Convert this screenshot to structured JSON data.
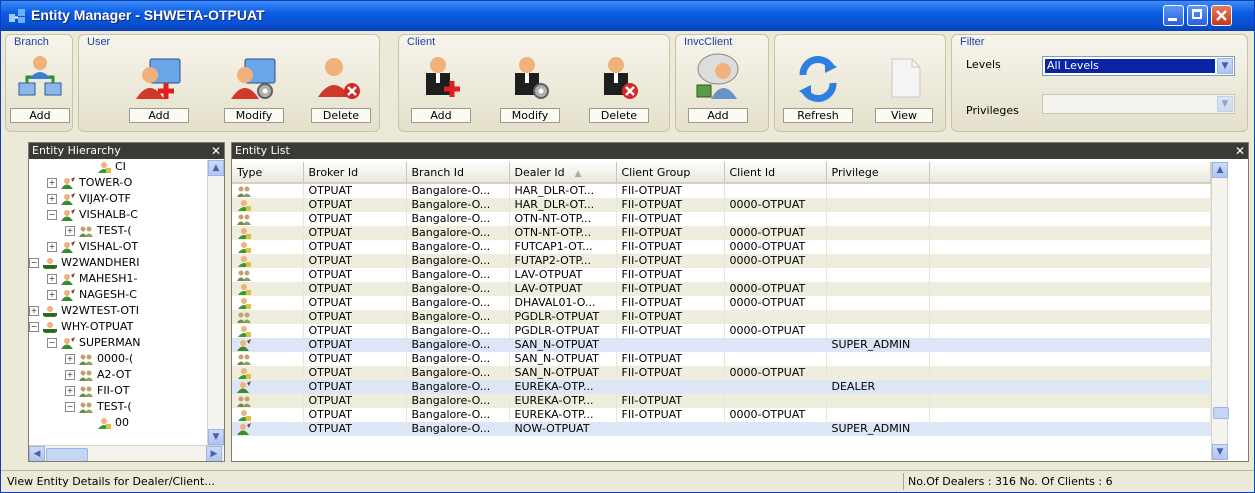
{
  "window": {
    "title": "Entity Manager - SHWETA-OTPUAT"
  },
  "toolbar": {
    "groups": [
      {
        "label": "Branch",
        "buttons": [
          "Add"
        ]
      },
      {
        "label": "User",
        "buttons": [
          "Add",
          "Modify",
          "Delete"
        ]
      },
      {
        "label": "Client",
        "buttons": [
          "Add",
          "Modify",
          "Delete"
        ]
      },
      {
        "label": "InvcClient",
        "buttons": [
          "Add"
        ]
      },
      {
        "label": "",
        "buttons": [
          "Refresh",
          "View"
        ]
      }
    ],
    "icons": {
      "branch_add": "branch-add-icon",
      "user_add": "user-add-icon",
      "user_modify": "user-modify-icon",
      "user_delete": "user-delete-icon",
      "client_add": "client-add-icon",
      "client_modify": "client-modify-icon",
      "client_delete": "client-delete-icon",
      "invc_add": "invc-client-add-icon",
      "refresh": "refresh-icon",
      "view": "view-document-icon"
    }
  },
  "filter": {
    "label": "Filter",
    "levels_label": "Levels",
    "levels_value": "All Levels",
    "privileges_label": "Privileges",
    "privileges_value": ""
  },
  "tree": {
    "title": "Entity Hierarchy",
    "items": [
      {
        "text": "CI",
        "indent": 5,
        "expander": "",
        "icon": "client"
      },
      {
        "text": "TOWER-O",
        "indent": 3,
        "expander": "+",
        "icon": "dealer"
      },
      {
        "text": "VIJAY-OTF",
        "indent": 3,
        "expander": "+",
        "icon": "dealer"
      },
      {
        "text": "VISHALB-C",
        "indent": 3,
        "expander": "-",
        "icon": "dealer"
      },
      {
        "text": "TEST-(",
        "indent": 4,
        "expander": "+",
        "icon": "group"
      },
      {
        "text": "VISHAL-OT",
        "indent": 3,
        "expander": "+",
        "icon": "dealer"
      },
      {
        "text": "W2WANDHERI",
        "indent": 2,
        "expander": "-",
        "icon": "branch"
      },
      {
        "text": "MAHESH1-",
        "indent": 3,
        "expander": "+",
        "icon": "dealer"
      },
      {
        "text": "NAGESH-C",
        "indent": 3,
        "expander": "+",
        "icon": "dealer"
      },
      {
        "text": "W2WTEST-OTI",
        "indent": 2,
        "expander": "+",
        "icon": "branch"
      },
      {
        "text": "WHY-OTPUAT",
        "indent": 2,
        "expander": "-",
        "icon": "branch"
      },
      {
        "text": "SUPERMAN",
        "indent": 3,
        "expander": "-",
        "icon": "dealer"
      },
      {
        "text": "0000-(",
        "indent": 4,
        "expander": "+",
        "icon": "group"
      },
      {
        "text": "A2-OT",
        "indent": 4,
        "expander": "+",
        "icon": "group"
      },
      {
        "text": "FII-OT",
        "indent": 4,
        "expander": "+",
        "icon": "group"
      },
      {
        "text": "TEST-(",
        "indent": 4,
        "expander": "-",
        "icon": "group"
      },
      {
        "text": "00",
        "indent": 5,
        "expander": "",
        "icon": "client"
      }
    ]
  },
  "list": {
    "title": "Entity List",
    "columns": [
      "Type",
      "Broker Id",
      "Branch Id",
      "Dealer Id",
      "Client Group",
      "Client Id",
      "Privilege"
    ],
    "sort_column": "Dealer Id",
    "rows": [
      {
        "type": "group",
        "broker": "OTPUAT",
        "branch": "Bangalore-O...",
        "dealer": "HAR_DLR-OT...",
        "group": "FII-OTPUAT",
        "client": "",
        "privilege": ""
      },
      {
        "type": "client",
        "broker": "OTPUAT",
        "branch": "Bangalore-O...",
        "dealer": "HAR_DLR-OT...",
        "group": "FII-OTPUAT",
        "client": "0000-OTPUAT",
        "privilege": ""
      },
      {
        "type": "group",
        "broker": "OTPUAT",
        "branch": "Bangalore-O...",
        "dealer": "OTN-NT-OTP...",
        "group": "FII-OTPUAT",
        "client": "",
        "privilege": ""
      },
      {
        "type": "client",
        "broker": "OTPUAT",
        "branch": "Bangalore-O...",
        "dealer": "OTN-NT-OTP...",
        "group": "FII-OTPUAT",
        "client": "0000-OTPUAT",
        "privilege": ""
      },
      {
        "type": "client",
        "broker": "OTPUAT",
        "branch": "Bangalore-O...",
        "dealer": "FUTCAP1-OT...",
        "group": "FII-OTPUAT",
        "client": "0000-OTPUAT",
        "privilege": ""
      },
      {
        "type": "client",
        "broker": "OTPUAT",
        "branch": "Bangalore-O...",
        "dealer": "FUTAP2-OTP...",
        "group": "FII-OTPUAT",
        "client": "0000-OTPUAT",
        "privilege": ""
      },
      {
        "type": "group",
        "broker": "OTPUAT",
        "branch": "Bangalore-O...",
        "dealer": "LAV-OTPUAT",
        "group": "FII-OTPUAT",
        "client": "",
        "privilege": ""
      },
      {
        "type": "client",
        "broker": "OTPUAT",
        "branch": "Bangalore-O...",
        "dealer": "LAV-OTPUAT",
        "group": "FII-OTPUAT",
        "client": "0000-OTPUAT",
        "privilege": ""
      },
      {
        "type": "client",
        "broker": "OTPUAT",
        "branch": "Bangalore-O...",
        "dealer": "DHAVAL01-O...",
        "group": "FII-OTPUAT",
        "client": "0000-OTPUAT",
        "privilege": ""
      },
      {
        "type": "group",
        "broker": "OTPUAT",
        "branch": "Bangalore-O...",
        "dealer": "PGDLR-OTPUAT",
        "group": "FII-OTPUAT",
        "client": "",
        "privilege": ""
      },
      {
        "type": "client",
        "broker": "OTPUAT",
        "branch": "Bangalore-O...",
        "dealer": "PGDLR-OTPUAT",
        "group": "FII-OTPUAT",
        "client": "0000-OTPUAT",
        "privilege": ""
      },
      {
        "type": "dealer",
        "broker": "OTPUAT",
        "branch": "Bangalore-O...",
        "dealer": "SAN_N-OTPUAT",
        "group": "",
        "client": "",
        "privilege": "SUPER_ADMIN"
      },
      {
        "type": "group",
        "broker": "OTPUAT",
        "branch": "Bangalore-O...",
        "dealer": "SAN_N-OTPUAT",
        "group": "FII-OTPUAT",
        "client": "",
        "privilege": ""
      },
      {
        "type": "client",
        "broker": "OTPUAT",
        "branch": "Bangalore-O...",
        "dealer": "SAN_N-OTPUAT",
        "group": "FII-OTPUAT",
        "client": "0000-OTPUAT",
        "privilege": ""
      },
      {
        "type": "dealer",
        "broker": "OTPUAT",
        "branch": "Bangalore-O...",
        "dealer": "EUREKA-OTP...",
        "group": "",
        "client": "",
        "privilege": "DEALER"
      },
      {
        "type": "group",
        "broker": "OTPUAT",
        "branch": "Bangalore-O...",
        "dealer": "EUREKA-OTP...",
        "group": "FII-OTPUAT",
        "client": "",
        "privilege": ""
      },
      {
        "type": "client",
        "broker": "OTPUAT",
        "branch": "Bangalore-O...",
        "dealer": "EUREKA-OTP...",
        "group": "FII-OTPUAT",
        "client": "0000-OTPUAT",
        "privilege": ""
      },
      {
        "type": "dealer",
        "broker": "OTPUAT",
        "branch": "Bangalore-O...",
        "dealer": "NOW-OTPUAT",
        "group": "",
        "client": "",
        "privilege": "SUPER_ADMIN"
      }
    ]
  },
  "status": {
    "left": "View Entity Details for Dealer/Client...",
    "right": "No.Of Dealers : 316 No. Of Clients : 6"
  },
  "colors": {
    "title_bar": "#0b5ce4",
    "group_label": "#1c3fa8",
    "selection": "#0a24a4",
    "panel_header": "#3b3a35"
  }
}
